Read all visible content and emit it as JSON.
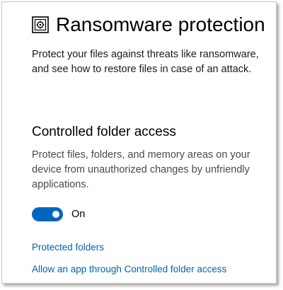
{
  "header": {
    "title": "Ransomware protection",
    "icon": "ransomware-protection-icon"
  },
  "intro": {
    "text": "Protect your files against threats like ransomware, and see how to restore files in case of an attack."
  },
  "controlled_folder_access": {
    "heading": "Controlled folder access",
    "description": "Protect files, folders, and memory areas on your device from unauthorized changes by unfriendly applications.",
    "toggle": {
      "state": "on",
      "label": "On",
      "color": "#0067c0"
    }
  },
  "links": {
    "protected_folders": "Protected folders",
    "allow_app": "Allow an app through Controlled folder access",
    "color": "#0063b1"
  }
}
